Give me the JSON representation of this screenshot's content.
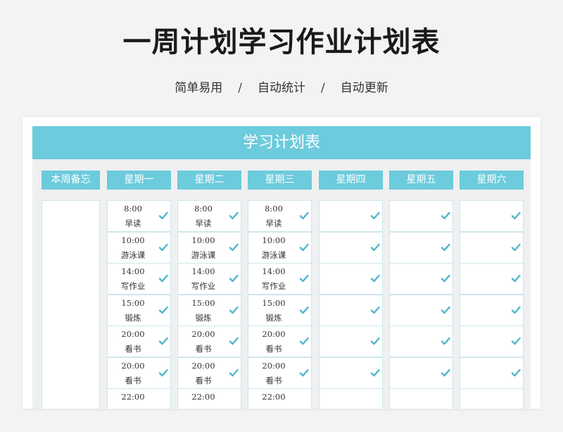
{
  "page": {
    "title": "一周计划学习作业计划表",
    "subtitle_items": [
      "简单易用",
      "自动统计",
      "自动更新"
    ],
    "separator": "/"
  },
  "sheet": {
    "title": "学习计划表",
    "memo_header": "本周备忘",
    "days": [
      {
        "name": "星期一",
        "slots": [
          {
            "time": "8:00",
            "task": "早读",
            "checked": true
          },
          {
            "time": "10:00",
            "task": "游泳课",
            "checked": true
          },
          {
            "time": "14:00",
            "task": "写作业",
            "checked": true
          },
          {
            "time": "15:00",
            "task": "锻炼",
            "checked": true
          },
          {
            "time": "20:00",
            "task": "看书",
            "checked": true
          },
          {
            "time": "20:00",
            "task": "看书",
            "checked": true
          },
          {
            "time": "22:00",
            "task": "",
            "checked": false
          }
        ]
      },
      {
        "name": "星期二",
        "slots": [
          {
            "time": "8:00",
            "task": "早读",
            "checked": true
          },
          {
            "time": "10:00",
            "task": "游泳课",
            "checked": true
          },
          {
            "time": "14:00",
            "task": "写作业",
            "checked": true
          },
          {
            "time": "15:00",
            "task": "锻炼",
            "checked": true
          },
          {
            "time": "20:00",
            "task": "看书",
            "checked": true
          },
          {
            "time": "20:00",
            "task": "看书",
            "checked": true
          },
          {
            "time": "22:00",
            "task": "",
            "checked": false
          }
        ]
      },
      {
        "name": "星期三",
        "slots": [
          {
            "time": "8:00",
            "task": "早读",
            "checked": true
          },
          {
            "time": "10:00",
            "task": "游泳课",
            "checked": true
          },
          {
            "time": "14:00",
            "task": "写作业",
            "checked": true
          },
          {
            "time": "15:00",
            "task": "锻炼",
            "checked": true
          },
          {
            "time": "20:00",
            "task": "看书",
            "checked": true
          },
          {
            "time": "20:00",
            "task": "看书",
            "checked": true
          },
          {
            "time": "22:00",
            "task": "",
            "checked": false
          }
        ]
      },
      {
        "name": "星期四",
        "slots": [
          {
            "time": "",
            "task": "",
            "checked": true
          },
          {
            "time": "",
            "task": "",
            "checked": true
          },
          {
            "time": "",
            "task": "",
            "checked": true
          },
          {
            "time": "",
            "task": "",
            "checked": true
          },
          {
            "time": "",
            "task": "",
            "checked": true
          },
          {
            "time": "",
            "task": "",
            "checked": true
          },
          {
            "time": "",
            "task": "",
            "checked": false
          }
        ]
      },
      {
        "name": "星期五",
        "slots": [
          {
            "time": "",
            "task": "",
            "checked": true
          },
          {
            "time": "",
            "task": "",
            "checked": true
          },
          {
            "time": "",
            "task": "",
            "checked": true
          },
          {
            "time": "",
            "task": "",
            "checked": true
          },
          {
            "time": "",
            "task": "",
            "checked": true
          },
          {
            "time": "",
            "task": "",
            "checked": true
          },
          {
            "time": "",
            "task": "",
            "checked": false
          }
        ]
      },
      {
        "name": "星期六",
        "slots": [
          {
            "time": "",
            "task": "",
            "checked": true
          },
          {
            "time": "",
            "task": "",
            "checked": true
          },
          {
            "time": "",
            "task": "",
            "checked": true
          },
          {
            "time": "",
            "task": "",
            "checked": true
          },
          {
            "time": "",
            "task": "",
            "checked": true
          },
          {
            "time": "",
            "task": "",
            "checked": true
          },
          {
            "time": "",
            "task": "",
            "checked": false
          }
        ]
      }
    ]
  },
  "colors": {
    "accent": "#6ccbdc",
    "check": "#4fb6cc",
    "cell_border": "#cfe6ec"
  },
  "icons": {
    "check": "check-icon"
  }
}
